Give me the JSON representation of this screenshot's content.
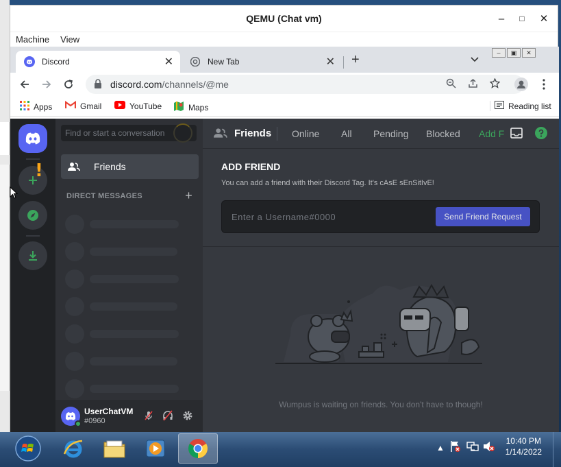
{
  "qemu": {
    "title": "QEMU (Chat vm)",
    "menu": [
      "Machine",
      "View"
    ],
    "controls": [
      "–",
      "□",
      "✕"
    ]
  },
  "chrome": {
    "tabs": [
      {
        "title": "Discord",
        "icon": "discord-icon",
        "active": true
      },
      {
        "title": "New Tab",
        "icon": "chrome-icon",
        "active": false
      }
    ],
    "url_domain": "discord.com",
    "url_path": "/channels/@me",
    "bookmarks": [
      {
        "label": "Apps",
        "icon": "apps-grid-icon"
      },
      {
        "label": "Gmail",
        "icon": "gmail-icon"
      },
      {
        "label": "YouTube",
        "icon": "youtube-icon"
      },
      {
        "label": "Maps",
        "icon": "maps-icon"
      }
    ],
    "reading_list": "Reading list"
  },
  "discord": {
    "search_placeholder": "Find or start a conversation",
    "friends_label": "Friends",
    "direct_messages": "DIRECT MESSAGES",
    "header": {
      "title": "Friends",
      "tabs": [
        "Online",
        "All",
        "Pending",
        "Blocked"
      ],
      "add_friend": "Add F"
    },
    "add_friend": {
      "title": "ADD FRIEND",
      "description": "You can add a friend with their Discord Tag. It's cAsE sEnSitIvE!",
      "placeholder": "Enter a Username#0000",
      "button": "Send Friend Request"
    },
    "empty_state": "Wumpus is waiting on friends. You don't have to though!",
    "user": {
      "name": "UserChatVM",
      "tag": "#0960"
    },
    "colors": {
      "blurple": "#5865f2",
      "green": "#3ba55c",
      "bg": "#36393f",
      "sidebar": "#2f3136",
      "guilds": "#202225"
    }
  },
  "taskbar": {
    "time": "10:40 PM",
    "date": "1/14/2022",
    "apps": [
      "start-orb",
      "internet-explorer-icon",
      "file-explorer-icon",
      "media-player-icon",
      "chrome-icon"
    ]
  }
}
